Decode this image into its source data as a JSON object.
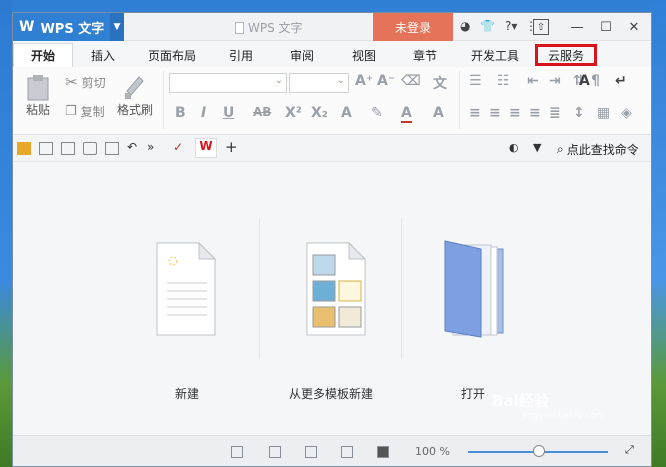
{
  "window": {
    "app_name": "WPS 文字",
    "doc_title": "WPS 文字",
    "login_label": "未登录"
  },
  "tabs": [
    {
      "label": "开始",
      "active": true
    },
    {
      "label": "插入"
    },
    {
      "label": "页面布局"
    },
    {
      "label": "引用"
    },
    {
      "label": "审阅"
    },
    {
      "label": "视图"
    },
    {
      "label": "章节"
    },
    {
      "label": "开发工具"
    },
    {
      "label": "云服务",
      "highlighted": true
    }
  ],
  "ribbon": {
    "paste_label": "粘贴",
    "cut_label": "剪切",
    "copy_label": "复制",
    "format_painter_label": "格式刷"
  },
  "quickbar": {
    "search_cmd_label": "点此查找命令"
  },
  "start": {
    "new_label": "新建",
    "template_label": "从更多模板新建",
    "open_label": "打开"
  },
  "status": {
    "zoom": "100 %"
  },
  "watermark": {
    "text": "Bai经验",
    "sub": "jingyan.baidu.com"
  },
  "colors": {
    "accent": "#2f7fd3",
    "login_bg": "#e4735a",
    "highlight_border": "#d9121c"
  }
}
